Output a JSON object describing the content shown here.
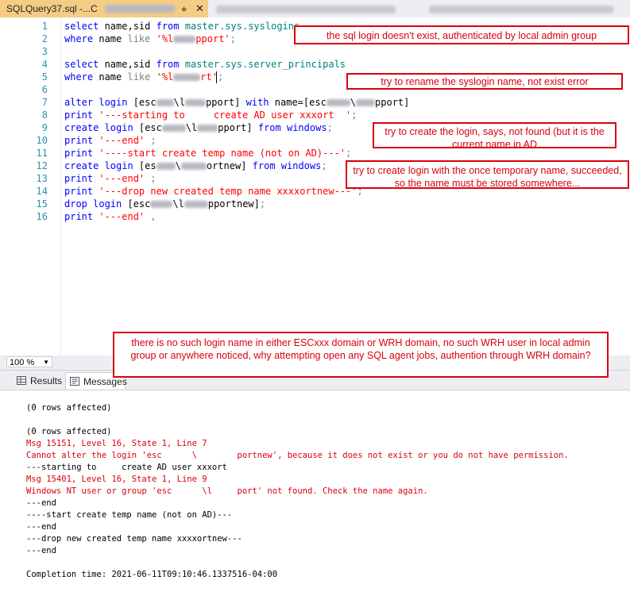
{
  "tabs": {
    "active": {
      "title": "SQLQuery37.sql -...C",
      "pin_icon": "pin-icon",
      "close_icon": "close-icon"
    }
  },
  "editor": {
    "lines": [
      {
        "n": "1",
        "segments": [
          [
            "kw",
            "select "
          ],
          [
            "",
            "name,sid "
          ],
          [
            "kw",
            "from "
          ],
          [
            "sys",
            "master.sys.syslogins"
          ]
        ]
      },
      {
        "n": "2",
        "segments": [
          [
            "kw",
            "where "
          ],
          [
            "",
            "name "
          ],
          [
            "gray",
            "like "
          ],
          [
            "str",
            "'%l"
          ],
          [
            "blur",
            ""
          ],
          [
            "str",
            "pport'"
          ],
          [
            "gray",
            ";"
          ]
        ]
      },
      {
        "n": "3",
        "segments": []
      },
      {
        "n": "4",
        "segments": [
          [
            "kw",
            "select "
          ],
          [
            "",
            "name,sid "
          ],
          [
            "kw",
            "from "
          ],
          [
            "sys",
            "master.sys.server_principals"
          ]
        ]
      },
      {
        "n": "5",
        "segments": [
          [
            "kw",
            "where "
          ],
          [
            "",
            "name "
          ],
          [
            "gray",
            "like "
          ],
          [
            "str",
            "'%l"
          ],
          [
            "blur",
            ""
          ],
          [
            "str",
            "rt'"
          ],
          [
            "gray",
            ";"
          ]
        ]
      },
      {
        "n": "6",
        "segments": []
      },
      {
        "n": "7",
        "segments": [
          [
            "kw",
            "alter login "
          ],
          [
            "",
            "[esc"
          ],
          [
            "blur",
            ""
          ],
          [
            "",
            "\\l"
          ],
          [
            "blur",
            ""
          ],
          [
            "",
            "pport] "
          ],
          [
            "kw",
            "with "
          ],
          [
            "",
            "name=[esc"
          ],
          [
            "blur",
            ""
          ],
          [
            "",
            "\\"
          ],
          [
            "blur",
            ""
          ],
          [
            "",
            "pport]"
          ]
        ]
      },
      {
        "n": "8",
        "segments": [
          [
            "kw",
            "print "
          ],
          [
            "str",
            "'---starting to     create AD user xxxort  '"
          ],
          [
            "gray",
            ";"
          ]
        ]
      },
      {
        "n": "9",
        "segments": [
          [
            "kw",
            "create login "
          ],
          [
            "",
            "[esc"
          ],
          [
            "blur",
            ""
          ],
          [
            "",
            "\\l"
          ],
          [
            "blur",
            ""
          ],
          [
            "",
            "pport] "
          ],
          [
            "kw",
            "from windows"
          ],
          [
            "gray",
            ";"
          ]
        ]
      },
      {
        "n": "10",
        "segments": [
          [
            "kw",
            "print "
          ],
          [
            "str",
            "'---end'"
          ],
          [
            "gray",
            " ;"
          ]
        ]
      },
      {
        "n": "11",
        "segments": [
          [
            "kw",
            "print "
          ],
          [
            "str",
            "'----start create temp name (not on AD)---'"
          ],
          [
            "gray",
            ";"
          ]
        ]
      },
      {
        "n": "12",
        "segments": [
          [
            "kw",
            "create login "
          ],
          [
            "",
            "[es"
          ],
          [
            "blur",
            ""
          ],
          [
            "",
            "\\"
          ],
          [
            "blur",
            ""
          ],
          [
            "",
            "ortnew] "
          ],
          [
            "kw",
            "from windows"
          ],
          [
            "gray",
            ";"
          ]
        ]
      },
      {
        "n": "13",
        "segments": [
          [
            "kw",
            "print "
          ],
          [
            "str",
            "'---end'"
          ],
          [
            "gray",
            " ;"
          ]
        ]
      },
      {
        "n": "14",
        "segments": [
          [
            "kw",
            "print "
          ],
          [
            "str",
            "'---drop new created temp name xxxxortnew---'"
          ],
          [
            "gray",
            ";"
          ]
        ]
      },
      {
        "n": "15",
        "segments": [
          [
            "kw",
            "drop login "
          ],
          [
            "",
            "[esc"
          ],
          [
            "blur",
            ""
          ],
          [
            "",
            "\\l"
          ],
          [
            "blur",
            ""
          ],
          [
            "",
            "pportnew]"
          ],
          [
            "gray",
            ";"
          ]
        ]
      },
      {
        "n": "16",
        "segments": [
          [
            "kw",
            "print "
          ],
          [
            "str",
            "'---end'"
          ],
          [
            "gray",
            " ,"
          ]
        ]
      }
    ]
  },
  "annotations": {
    "a1": "the sql login doesn't exist, authenticated by local admin group",
    "a2": "try to rename the syslogin name, not exist error",
    "a3": "try to create the login, says, not found (but it is the current name in AD",
    "a4": "try to create login with the once temporary name, succeeded, so the name must be stored somewhere...",
    "a5": "there is no such login name in either ESCxxx domain or WRH domain, no such WRH user in local admin group or anywhere noticed, why attempting open any SQL agent jobs, authention through WRH domain?"
  },
  "zoom": {
    "value": "100 %",
    "caret_icon": "chevron-down-icon"
  },
  "results_tabs": [
    {
      "label": "Results",
      "icon": "grid-icon"
    },
    {
      "label": "Messages",
      "icon": "messages-icon"
    }
  ],
  "messages": [
    {
      "text": "(0 rows affected)",
      "err": false
    },
    {
      "text": "",
      "err": false
    },
    {
      "text": "(0 rows affected)",
      "err": false
    },
    {
      "text": "Msg 15151, Level 16, State 1, Line 7",
      "err": true
    },
    {
      "text": "Cannot alter the login 'esc      \\        portnew', because it does not exist or you do not have permission.",
      "err": true
    },
    {
      "text": "---starting to     create AD user xxxort",
      "err": false
    },
    {
      "text": "Msg 15401, Level 16, State 1, Line 9",
      "err": true
    },
    {
      "text": "Windows NT user or group 'esc      \\l     port' not found. Check the name again.",
      "err": true
    },
    {
      "text": "---end",
      "err": false
    },
    {
      "text": "----start create temp name (not on AD)---",
      "err": false
    },
    {
      "text": "---end",
      "err": false
    },
    {
      "text": "---drop new created temp name xxxxortnew---",
      "err": false
    },
    {
      "text": "---end",
      "err": false
    },
    {
      "text": "",
      "err": false
    },
    {
      "text": "Completion time: 2021-06-11T09:10:46.1337516-04:00",
      "err": false
    }
  ],
  "colors": {
    "tab_accent": "#f5cc84",
    "error_red": "#d9000d",
    "keyword_blue": "#0000ff",
    "string_red": "#ff0000"
  }
}
